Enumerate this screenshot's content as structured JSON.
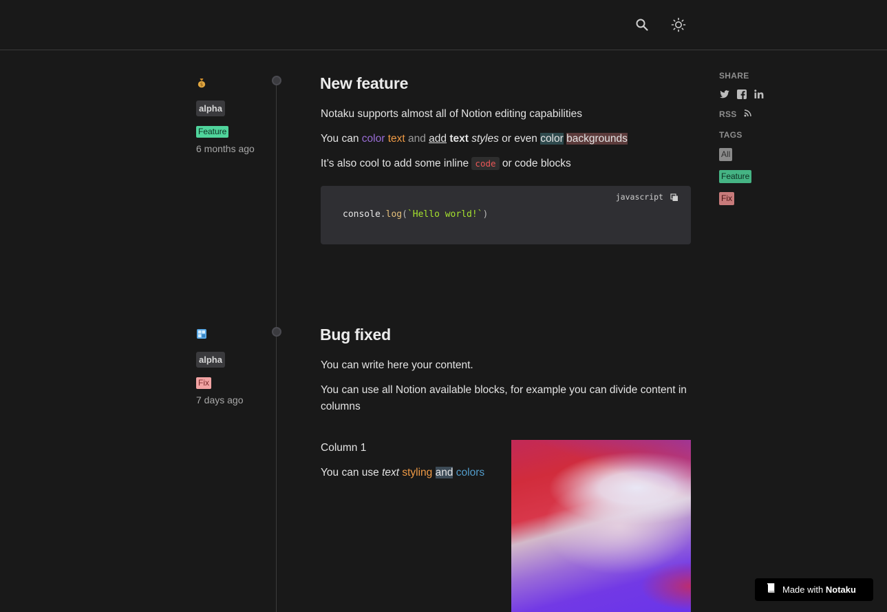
{
  "posts": [
    {
      "emoji": "money-bag-emoji",
      "author": "alpha",
      "tag": "Feature",
      "date": "6 months ago",
      "title": "New feature",
      "p1": "Notaku supports almost all of Notion editing capabilities",
      "p2": {
        "a": "You can ",
        "b": "color",
        "c": " ",
        "d": "text",
        "e": " ",
        "f": "and",
        "g": " ",
        "h": "add",
        "i": " ",
        "j": "text",
        "k": " ",
        "l": "styles",
        "m": " or even ",
        "n": "color",
        "o": " ",
        "p": "backgrounds"
      },
      "p3": {
        "a": "It’s also cool to add some inline ",
        "b": "code",
        "c": " or code blocks"
      },
      "code": {
        "language": "javascript",
        "t1": "console",
        "t2": ".",
        "t3": "log",
        "t4": "(",
        "t5": "`Hello world!`",
        "t6": ")"
      }
    },
    {
      "emoji": "window-emoji",
      "author": "alpha",
      "tag": "Fix",
      "date": "7 days ago",
      "title": "Bug fixed",
      "p1": "You can write here your content.",
      "p2": "You can use all Notion available blocks, for example you can divide content in columns",
      "column_title": "Column 1",
      "col_p": {
        "a": "You can use ",
        "b": "text",
        "c": " ",
        "d": "styling",
        "e": " ",
        "f": "and",
        "g": " ",
        "h": "colors"
      }
    }
  ],
  "sidebar": {
    "share_label": "SHARE",
    "rss_label": "RSS",
    "tags_label": "TAGS",
    "tags": [
      "All",
      "Feature",
      "Fix"
    ]
  },
  "badge": {
    "prefix": "Made with ",
    "brand": "Notaku"
  },
  "colors": {
    "background": "#191919",
    "feature": "#50d49c",
    "fix": "#f2a3a3"
  }
}
